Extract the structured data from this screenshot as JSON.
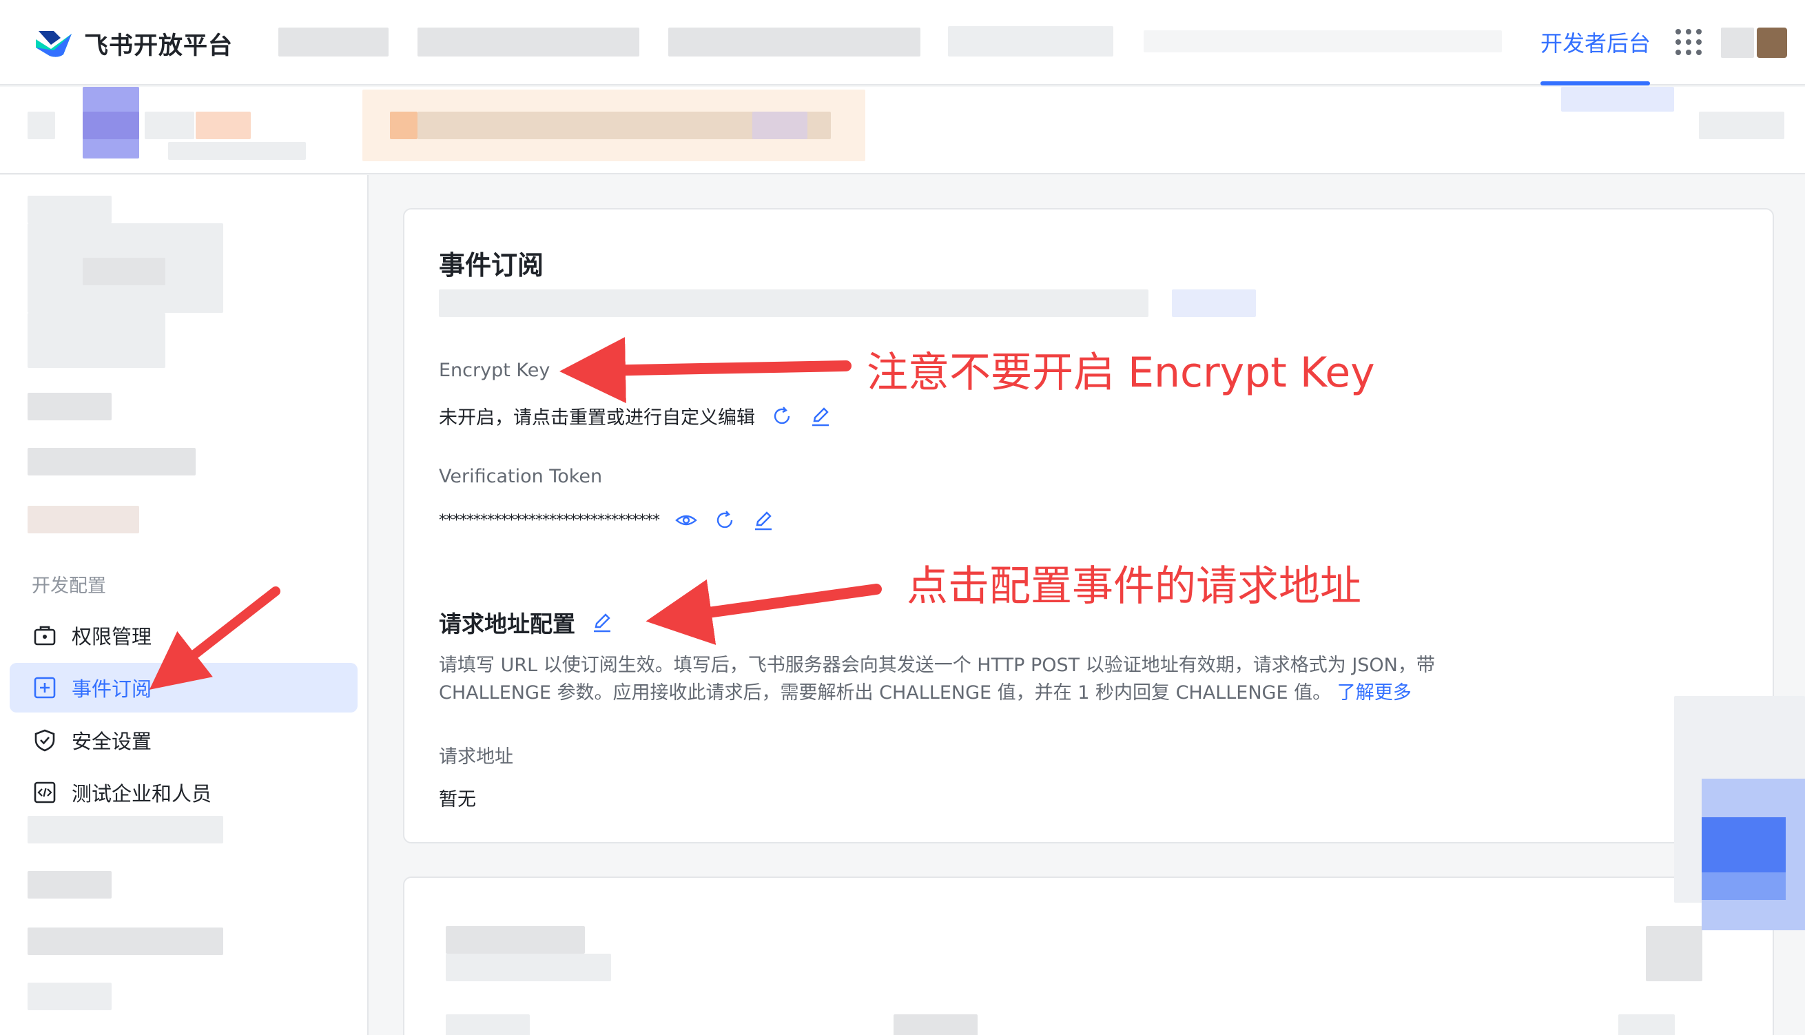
{
  "header": {
    "logo_text": "飞书开放平台",
    "dev_console": "开发者后台"
  },
  "sidebar": {
    "section_title": "开发配置",
    "items": [
      {
        "label": "权限管理",
        "icon": "permission-icon",
        "active": false
      },
      {
        "label": "事件订阅",
        "icon": "event-icon",
        "active": true
      },
      {
        "label": "安全设置",
        "icon": "shield-icon",
        "active": false
      },
      {
        "label": "测试企业和人员",
        "icon": "code-icon",
        "active": false
      }
    ]
  },
  "main": {
    "title": "事件订阅",
    "encrypt_key": {
      "label": "Encrypt Key",
      "value": "未开启，请点击重置或进行自定义编辑"
    },
    "verification_token": {
      "label": "Verification Token",
      "value": "********************************"
    },
    "request_url_config": {
      "title": "请求地址配置",
      "description": "请填写 URL 以使订阅生效。填写后，飞书服务器会向其发送一个 HTTP POST 以验证地址有效期，请求格式为 JSON，带 CHALLENGE 参数。应用接收此请求后，需要解析出 CHALLENGE 值，并在 1 秒内回复 CHALLENGE 值。",
      "learn_more": "了解更多",
      "url_label": "请求地址",
      "url_value": "暂无"
    }
  },
  "annotations": {
    "encrypt_note": "注意不要开启 Encrypt Key",
    "request_url_note": "点击配置事件的请求地址"
  },
  "colors": {
    "accent": "#3370ff",
    "annotation": "#f04040",
    "active_bg": "#e1eaff"
  }
}
